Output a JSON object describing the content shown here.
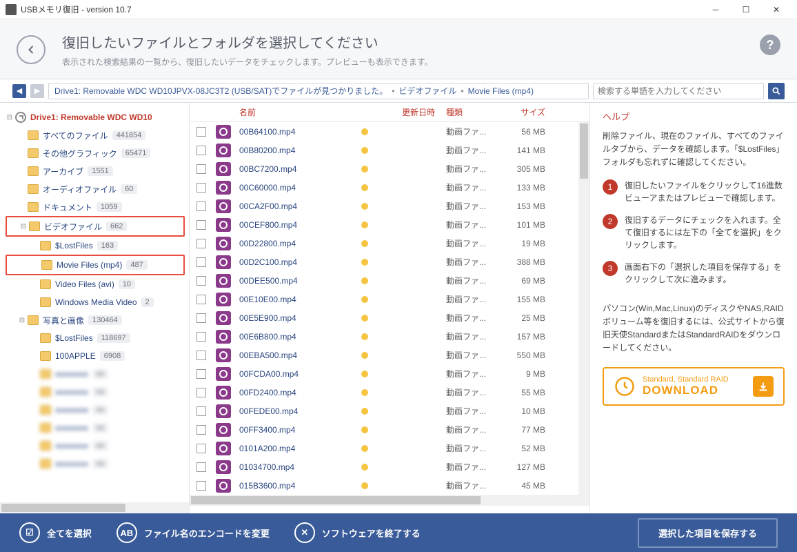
{
  "window": {
    "title": "USBメモリ復旧 - version 10.7"
  },
  "header": {
    "title": "復旧したいファイルとフォルダを選択してください",
    "subtitle": "表示された検索結果の一覧から、復旧したいデータをチェックします。プレビューも表示できます。"
  },
  "breadcrumb": {
    "path": "Drive1: Removable WDC WD10JPVX-08JC3T2 (USB/SAT)でファイルが見つかりました。",
    "seg1": "ビデオファイル",
    "seg2": "Movie Files (mp4)"
  },
  "search": {
    "placeholder": "検索する単語を入力してください"
  },
  "tree": {
    "root": "Drive1: Removable WDC WD10",
    "items": [
      {
        "label": "すべてのファイル",
        "count": "441854"
      },
      {
        "label": "その他グラフィック",
        "count": "65471"
      },
      {
        "label": "アーカイブ",
        "count": "1551"
      },
      {
        "label": "オーディオファイル",
        "count": "60"
      },
      {
        "label": "ドキュメント",
        "count": "1059"
      },
      {
        "label": "ビデオファイル",
        "count": "662"
      },
      {
        "label": "$LostFiles",
        "count": "163"
      },
      {
        "label": "Movie Files (mp4)",
        "count": "487"
      },
      {
        "label": "Video Files (avi)",
        "count": "10"
      },
      {
        "label": "Windows Media Video",
        "count": "2"
      },
      {
        "label": "写真と画像",
        "count": "130464"
      },
      {
        "label": "$LostFiles",
        "count": "118697"
      },
      {
        "label": "100APPLE",
        "count": "6908"
      }
    ]
  },
  "columns": {
    "name": "名前",
    "date": "更新日時",
    "type": "種類",
    "size": "サイズ"
  },
  "file_type": "動画ファ...",
  "files": [
    {
      "name": "00B64100.mp4",
      "size": "56 MB"
    },
    {
      "name": "00B80200.mp4",
      "size": "141 MB"
    },
    {
      "name": "00BC7200.mp4",
      "size": "305 MB"
    },
    {
      "name": "00C60000.mp4",
      "size": "133 MB"
    },
    {
      "name": "00CA2F00.mp4",
      "size": "153 MB"
    },
    {
      "name": "00CEF800.mp4",
      "size": "101 MB"
    },
    {
      "name": "00D22800.mp4",
      "size": "19 MB"
    },
    {
      "name": "00D2C100.mp4",
      "size": "388 MB"
    },
    {
      "name": "00DEE500.mp4",
      "size": "69 MB"
    },
    {
      "name": "00E10E00.mp4",
      "size": "155 MB"
    },
    {
      "name": "00E5E900.mp4",
      "size": "25 MB"
    },
    {
      "name": "00E6B800.mp4",
      "size": "157 MB"
    },
    {
      "name": "00EBA500.mp4",
      "size": "550 MB"
    },
    {
      "name": "00FCDA00.mp4",
      "size": "9 MB"
    },
    {
      "name": "00FD2400.mp4",
      "size": "55 MB"
    },
    {
      "name": "00FEDE00.mp4",
      "size": "10 MB"
    },
    {
      "name": "00FF3400.mp4",
      "size": "77 MB"
    },
    {
      "name": "0101A200.mp4",
      "size": "52 MB"
    },
    {
      "name": "01034700.mp4",
      "size": "127 MB"
    },
    {
      "name": "015B3600.mp4",
      "size": "45 MB"
    }
  ],
  "help": {
    "title": "ヘルプ",
    "intro": "削除ファイル、現在のファイル、すべてのファイルタブから、データを確認します。「$LostFiles」フォルダも忘れずに確認してください。",
    "steps": [
      "復旧したいファイルをクリックして16進数ビューアまたはプレビューで確認します。",
      "復旧するデータにチェックを入れます。全て復旧するには左下の「全てを選択」をクリックします。",
      "画面右下の「選択した項目を保存する」をクリックして次に進みます。"
    ],
    "note": "パソコン(Win,Mac,Linux)のディスクやNAS,RAIDボリューム等を復旧するには、公式サイトから復旧天使StandardまたはStandardRAIDをダウンロードしてください。",
    "dl1": "Standard, Standard RAID",
    "dl2": "DOWNLOAD"
  },
  "footer": {
    "select_all": "全てを選択",
    "encoding": "ファイル名のエンコードを変更",
    "exit": "ソフトウェアを終了する",
    "save": "選択した項目を保存する"
  }
}
